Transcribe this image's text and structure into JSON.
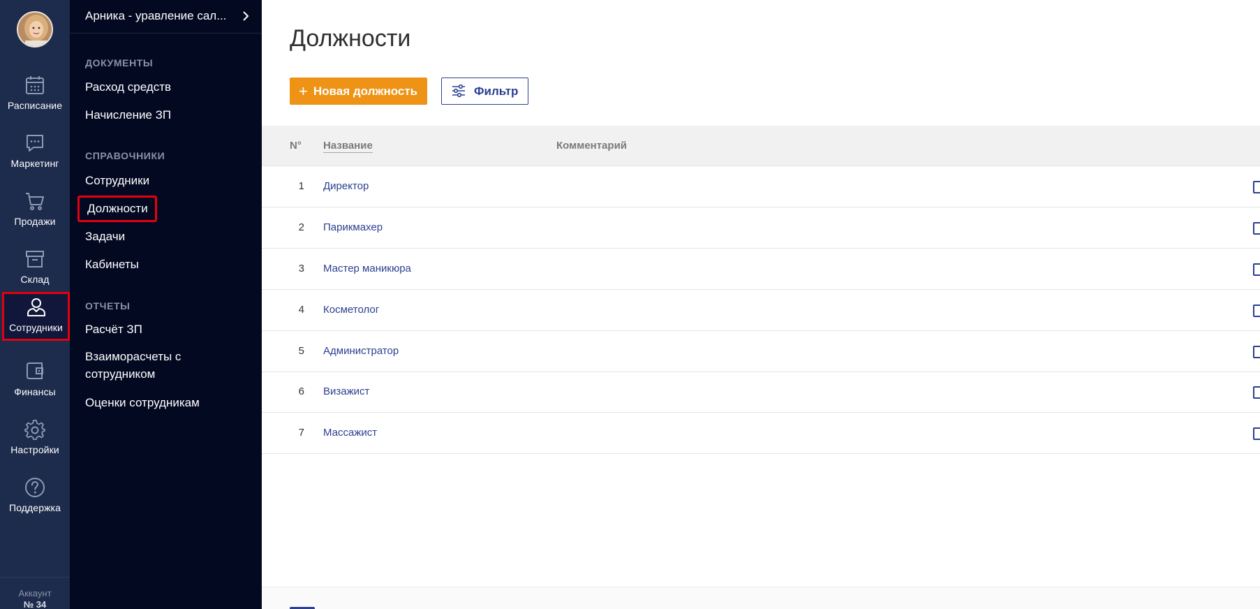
{
  "rail": {
    "items": [
      {
        "label": "Расписание",
        "icon": "calendar-icon"
      },
      {
        "label": "Маркетинг",
        "icon": "chat-bubble-icon"
      },
      {
        "label": "Продажи",
        "icon": "cart-icon"
      },
      {
        "label": "Склад",
        "icon": "archive-box-icon"
      },
      {
        "label": "Сотрудники",
        "icon": "user-icon"
      },
      {
        "label": "Финансы",
        "icon": "wallet-icon"
      },
      {
        "label": "Настройки",
        "icon": "gear-icon"
      },
      {
        "label": "Поддержка",
        "icon": "help-circle-icon"
      }
    ],
    "active": "Сотрудники",
    "account_label": "Аккаунт",
    "account_number": "№ 34"
  },
  "submenu": {
    "title": "Арника - уравление сал...",
    "sections": [
      {
        "heading": "ДОКУМЕНТЫ",
        "links": [
          "Расход средств",
          "Начисление ЗП"
        ]
      },
      {
        "heading": "СПРАВОЧНИКИ",
        "links": [
          "Сотрудники",
          "Должности",
          "Задачи",
          "Кабинеты"
        ]
      },
      {
        "heading": "ОТЧЕТЫ",
        "links": [
          "Расчёт ЗП",
          "Взаиморасчеты с сотрудником",
          "Оценки сотрудникам"
        ]
      }
    ],
    "active_link": "Должности"
  },
  "main": {
    "title": "Должности",
    "new_button": "Новая должность",
    "filter_button": "Фильтр",
    "columns": {
      "num": "N°",
      "name": "Название",
      "comment": "Комментарий"
    },
    "rows": [
      {
        "num": "1",
        "name": "Директор",
        "comment": ""
      },
      {
        "num": "2",
        "name": "Парикмахер",
        "comment": ""
      },
      {
        "num": "3",
        "name": "Мастер маникюра",
        "comment": ""
      },
      {
        "num": "4",
        "name": "Косметолог",
        "comment": ""
      },
      {
        "num": "5",
        "name": "Администратор",
        "comment": ""
      },
      {
        "num": "6",
        "name": "Визажист",
        "comment": ""
      },
      {
        "num": "7",
        "name": "Массажист",
        "comment": ""
      }
    ]
  },
  "colors": {
    "rail_bg": "#1d2b4c",
    "submenu_bg": "#040922",
    "accent_orange": "#ee9315",
    "link_blue": "#2c3f8f",
    "highlight_red": "#e3000f"
  }
}
